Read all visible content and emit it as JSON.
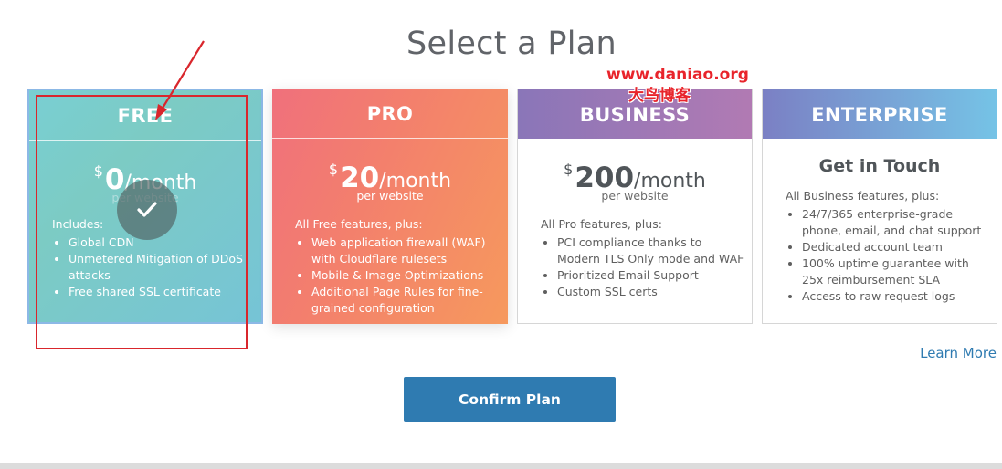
{
  "page": {
    "title": "Select a Plan"
  },
  "plans": [
    {
      "name": "FREE",
      "currency": "$",
      "amount": "0",
      "period": "/month",
      "per": "per website",
      "features_intro": "Includes:",
      "features": [
        "Global CDN",
        "Unmetered Mitigation of DDoS attacks",
        "Free shared SSL certificate"
      ],
      "selected": true
    },
    {
      "name": "PRO",
      "currency": "$",
      "amount": "20",
      "period": "/month",
      "per": "per website",
      "features_intro": "All Free features, plus:",
      "features": [
        "Web application firewall (WAF) with Cloudflare rulesets",
        "Mobile & Image Optimizations",
        "Additional Page Rules for fine-grained configuration"
      ]
    },
    {
      "name": "BUSINESS",
      "currency": "$",
      "amount": "200",
      "period": "/month",
      "per": "per website",
      "features_intro": "All Pro features, plus:",
      "features": [
        "PCI compliance thanks to Modern TLS Only mode and WAF",
        "Prioritized Email Support",
        "Custom SSL certs"
      ]
    },
    {
      "name": "ENTERPRISE",
      "contact": "Get in Touch",
      "features_intro": "All Business features, plus:",
      "features": [
        "24/7/365 enterprise-grade phone, email, and chat support",
        "Dedicated account team",
        "100% uptime guarantee with 25x reimbursement SLA",
        "Access to raw request logs"
      ]
    }
  ],
  "links": {
    "learn_more": "Learn More"
  },
  "actions": {
    "confirm": "Confirm Plan"
  },
  "watermark": {
    "url": "www.daniao.org",
    "cn": "大鸟博客"
  },
  "icons": {
    "selected": "checkmark-icon"
  },
  "colors": {
    "accent": "#2f7bb1",
    "free_gradient": [
      "#79cfd3",
      "#76c4d6"
    ],
    "pro_gradient": [
      "#f0707c",
      "#f6995d"
    ],
    "business_header": [
      "#8a76b8",
      "#b17ab3"
    ],
    "enterprise_header": [
      "#7b80c4",
      "#75c3e6"
    ],
    "annotation": "#d9262c"
  }
}
